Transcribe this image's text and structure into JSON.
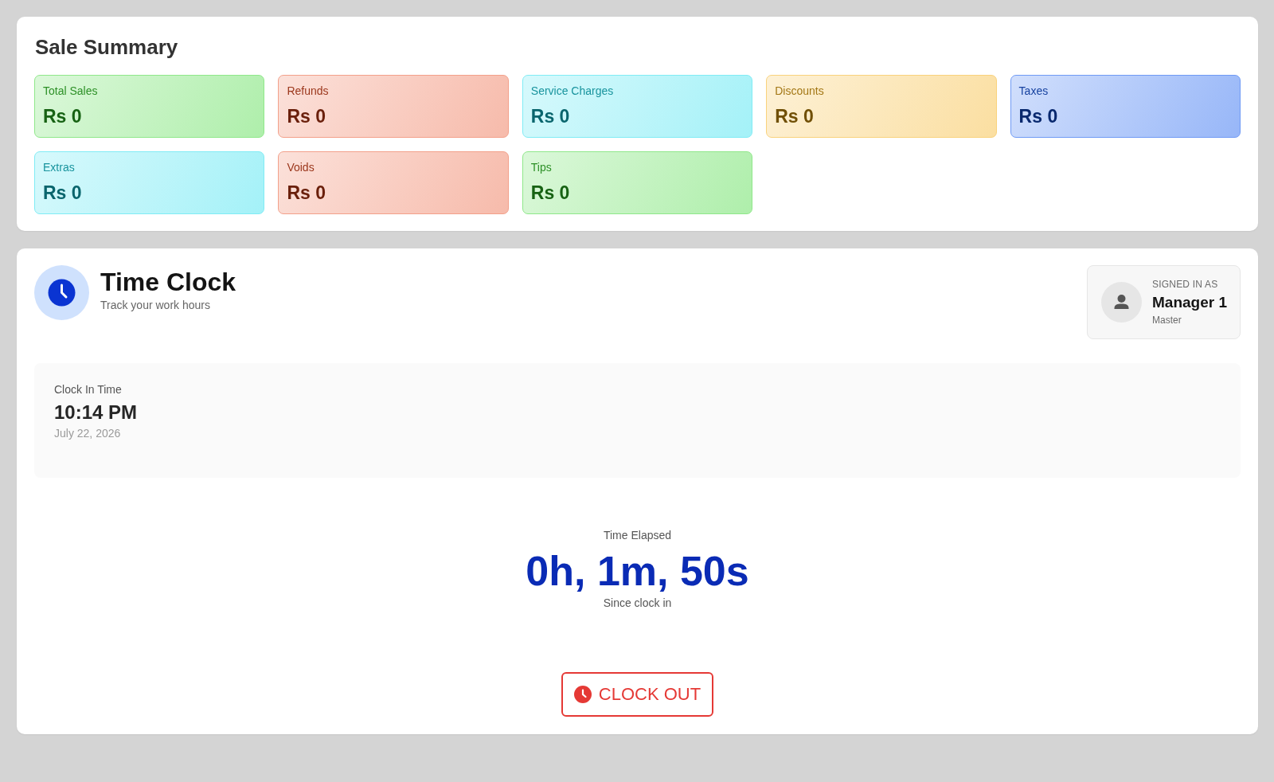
{
  "sale_summary": {
    "title": "Sale Summary",
    "cards": [
      {
        "label": "Total Sales",
        "value": "Rs 0",
        "color": "#8fe88a"
      },
      {
        "label": "Refunds",
        "value": "Rs 0",
        "color": "#f3a08a"
      },
      {
        "label": "Service Charges",
        "value": "Rs 0",
        "color": "#80ecf5"
      },
      {
        "label": "Discounts",
        "value": "Rs 0",
        "color": "#f9d27c"
      },
      {
        "label": "Taxes",
        "value": "Rs 0",
        "color": "#6f9af5"
      },
      {
        "label": "Extras",
        "value": "Rs 0",
        "color": "#80ecf5"
      },
      {
        "label": "Voids",
        "value": "Rs 0",
        "color": "#f3a08a"
      },
      {
        "label": "Tips",
        "value": "Rs 0",
        "color": "#8fe88a"
      }
    ]
  },
  "time_clock": {
    "title": "Time Clock",
    "subtitle": "Track your work hours",
    "signed_in": {
      "caption": "SIGNED IN AS",
      "name": "Manager 1",
      "role": "Master"
    },
    "clock_in": {
      "label": "Clock In Time",
      "time": "10:14 PM",
      "date": "July 22, 2026"
    },
    "elapsed": {
      "label": "Time Elapsed",
      "value": "0h, 1m, 50s",
      "note": "Since clock in"
    },
    "button": "CLOCK OUT"
  }
}
